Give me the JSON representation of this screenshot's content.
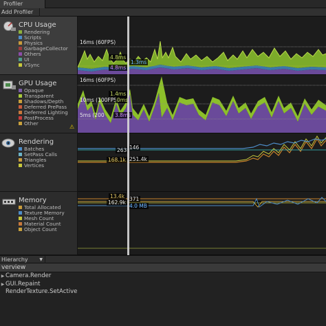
{
  "window": {
    "tab_title": "Profiler",
    "add_profiler": "Add Profiler"
  },
  "cpu": {
    "title": "CPU Usage",
    "items": [
      {
        "label": "Rendering",
        "color": "#8cb03c"
      },
      {
        "label": "Scripts",
        "color": "#4d8cc8"
      },
      {
        "label": "Physics",
        "color": "#c89b3c"
      },
      {
        "label": "GarbageCollector",
        "color": "#9c3c3c"
      },
      {
        "label": "Others",
        "color": "#8c4ca8"
      },
      {
        "label": "UI",
        "color": "#4c9c8c"
      },
      {
        "label": "VSync",
        "color": "#c8c83c"
      }
    ],
    "threshold_label": "16ms (60FPS)",
    "tags": [
      {
        "text": "4.8ms",
        "color": "#c8dc64"
      },
      {
        "text": "1.3ms",
        "color": "#6cb4ff"
      },
      {
        "text": "4.8ms",
        "color": "#cc88ff"
      }
    ]
  },
  "gpu": {
    "title": "GPU Usage",
    "items": [
      {
        "label": "Opaque",
        "color": "#7c5ca8"
      },
      {
        "label": "Transparent",
        "color": "#a8c83c"
      },
      {
        "label": "Shadows/Depth",
        "color": "#c8a03c"
      },
      {
        "label": "Deferred PrePass",
        "color": "#c85c3c"
      },
      {
        "label": "Deferred Lighting",
        "color": "#c8783c"
      },
      {
        "label": "PostProcess",
        "color": "#c83c3c"
      },
      {
        "label": "Other",
        "color": "#c8a03c"
      }
    ],
    "threshold_labels": [
      "16ms (60FPS)",
      "10ms (100FPS)",
      "5ms (200"
    ],
    "tags": [
      {
        "text": "1.4ms",
        "color": "#c8dc64"
      },
      {
        "text": "0ms",
        "color": "#c8dc64"
      },
      {
        "text": "3.8ms",
        "color": "#cc88ff"
      }
    ],
    "warning": "⚠"
  },
  "rendering": {
    "title": "Rendering",
    "items": [
      {
        "label": "Batches",
        "color": "#4d8cc8"
      },
      {
        "label": "SetPass Calls",
        "color": "#6cb4c8"
      },
      {
        "label": "Triangles",
        "color": "#c89b3c"
      },
      {
        "label": "Vertices",
        "color": "#c8c83c"
      }
    ],
    "tags": [
      {
        "text": "263",
        "color": "#e6e6e6"
      },
      {
        "text": "146",
        "color": "#e6e6e6"
      },
      {
        "text": "168.1k",
        "color": "#e6c864"
      },
      {
        "text": "251.4k",
        "color": "#e6e6e6"
      }
    ]
  },
  "memory": {
    "title": "Memory",
    "items": [
      {
        "label": "Total Allocated",
        "color": "#c89b3c"
      },
      {
        "label": "Texture Memory",
        "color": "#4d8cc8"
      },
      {
        "label": "Mesh Count",
        "color": "#c8c83c"
      },
      {
        "label": "Material Count",
        "color": "#c8783c"
      },
      {
        "label": "Object Count",
        "color": "#c8a03c"
      }
    ],
    "tags": [
      {
        "text": "13.4k",
        "color": "#e6c864"
      },
      {
        "text": "371",
        "color": "#e6e6e6"
      },
      {
        "text": "162.9k",
        "color": "#e6e6e6"
      },
      {
        "text": "4.0 MB",
        "color": "#6cb4ff"
      }
    ]
  },
  "hierarchy": {
    "tab_label": "Hierarchy",
    "overview_header": "verview",
    "rows": [
      {
        "label": "Camera.Render",
        "expandable": true
      },
      {
        "label": "GUI.Repaint",
        "expandable": true
      },
      {
        "label": "RenderTexture.SetActive",
        "expandable": false
      }
    ]
  }
}
